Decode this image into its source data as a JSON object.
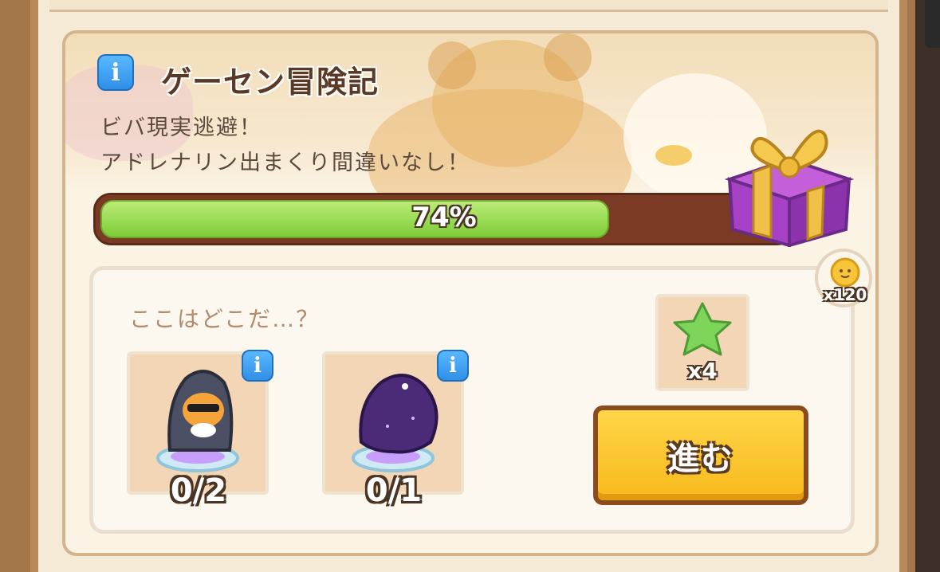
{
  "event": {
    "title": "ゲーセン冒険記",
    "description_line1": "ビバ現実逃避！",
    "description_line2": "アドレナリン出まくり間違いなし！",
    "progress_percent": 74,
    "progress_label": "74%"
  },
  "reward": {
    "coin_amount": "x120",
    "icons": [
      "info-icon",
      "gift-box-icon",
      "sun-coin-icon"
    ]
  },
  "stage": {
    "title": "ここはどこだ…？",
    "slots": [
      {
        "name": "hooded-duck-character",
        "count": "0/2",
        "info": "i"
      },
      {
        "name": "shadow-monster-character",
        "count": "0/1",
        "info": "i"
      }
    ],
    "item_reward": {
      "icon": "green-star-icon",
      "count": "x4"
    },
    "go_button_label": "進む"
  },
  "info_label": "i",
  "colors": {
    "progress_fill": "#8fd448",
    "progress_track": "#7a3a24",
    "button": "#f9c52a",
    "info": "#3a9cf0"
  }
}
